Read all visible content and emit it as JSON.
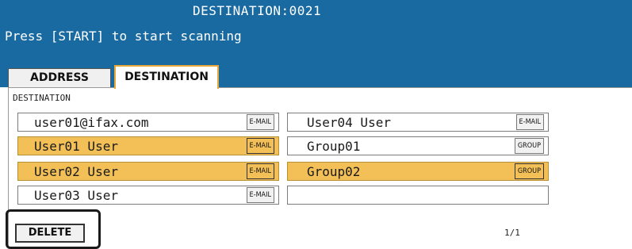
{
  "header": {
    "title": "DESTINATION:0021",
    "message": "Press [START] to start scanning"
  },
  "tabs": [
    {
      "label": "ADDRESS",
      "selected": false
    },
    {
      "label": "DESTINATION",
      "selected": true
    }
  ],
  "section_label": "DESTINATION",
  "destinations": [
    {
      "name": "user01@ifax.com",
      "type": "E-MAIL",
      "selected": false
    },
    {
      "name": "User01 User",
      "type": "E-MAIL",
      "selected": true
    },
    {
      "name": "User02 User",
      "type": "E-MAIL",
      "selected": true
    },
    {
      "name": "User03 User",
      "type": "E-MAIL",
      "selected": false
    },
    {
      "name": "User04 User",
      "type": "E-MAIL",
      "selected": false
    },
    {
      "name": "Group01",
      "type": "GROUP",
      "selected": false
    },
    {
      "name": "Group02",
      "type": "GROUP",
      "selected": true
    },
    {
      "name": "",
      "type": "",
      "selected": false
    }
  ],
  "delete_label": "DELETE",
  "page_indicator": "1/1",
  "colors": {
    "header_bg": "#1a6aa2",
    "selected_row": "#f2c057",
    "tab_active_border": "#e9a93a"
  }
}
